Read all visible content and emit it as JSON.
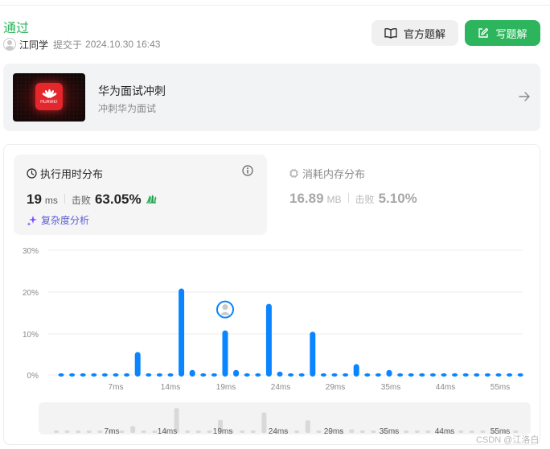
{
  "status": "通过",
  "submission": {
    "user": "江同学",
    "submitted_label": "提交于",
    "time": "2024.10.30 16:43"
  },
  "buttons": {
    "official_solution": "官方题解",
    "write_solution": "写题解"
  },
  "banner": {
    "title": "华为面试冲刺",
    "subtitle": "冲刺华为面试",
    "logo_text": "HUAWEI",
    "icon": "arrow-right-icon"
  },
  "runtime_card": {
    "title": "执行用时分布",
    "value": "19",
    "unit": "ms",
    "beat_label": "击败",
    "beat_pct": "63.05%",
    "analysis_link": "复杂度分析"
  },
  "memory_card": {
    "title": "消耗内存分布",
    "value": "16.89",
    "unit": "MB",
    "beat_label": "击败",
    "beat_pct": "5.10%"
  },
  "colors": {
    "accepted_green": "#2db55d",
    "bar_blue": "#0a84ff",
    "minimap_bar": "#d9d9d9"
  },
  "chart_data": {
    "type": "bar",
    "ylim": [
      0,
      30
    ],
    "yticks": [
      "30%",
      "20%",
      "10%",
      "0%"
    ],
    "xticks": [
      "7ms",
      "14ms",
      "19ms",
      "24ms",
      "29ms",
      "35ms",
      "44ms",
      "55ms"
    ],
    "values": [
      0.8,
      0.8,
      0.8,
      0.8,
      0.8,
      0.8,
      0.8,
      5.9,
      0.8,
      0.8,
      0.8,
      21.2,
      1.6,
      0.8,
      0.8,
      11.1,
      1.6,
      0.8,
      0.8,
      17.5,
      1.2,
      0.8,
      0.8,
      10.8,
      0.8,
      0.8,
      0.8,
      3.0,
      0.8,
      0.8,
      1.6,
      0.8,
      0.8,
      0.8,
      0.8,
      0.8,
      0.8,
      0.8,
      0.8,
      0.8,
      0.8,
      0.8,
      0.8
    ],
    "highlight_index": 15
  },
  "minimap": {
    "xticks": [
      "7ms",
      "14ms",
      "19ms",
      "24ms",
      "29ms",
      "35ms",
      "44ms",
      "55ms"
    ]
  },
  "watermark": "CSDN @江洛白"
}
